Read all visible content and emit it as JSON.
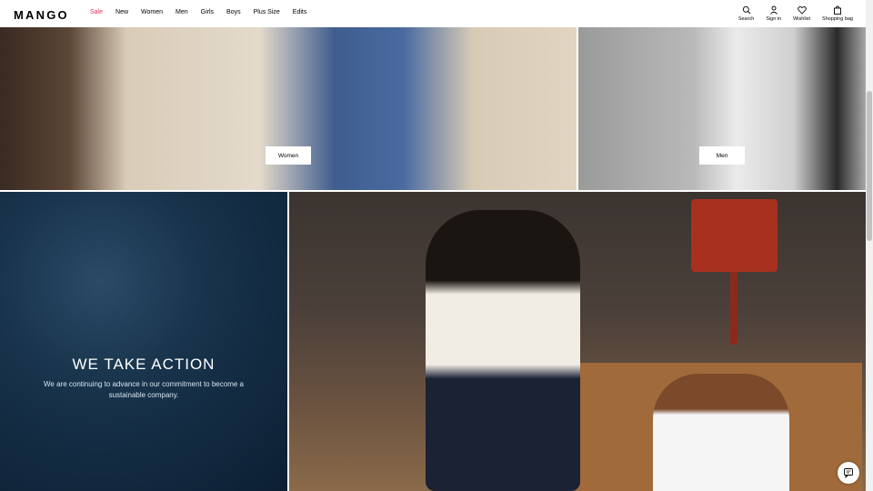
{
  "header": {
    "logo": "MANGO",
    "nav": [
      "Sale",
      "New",
      "Women",
      "Men",
      "Girls",
      "Boys",
      "Plus Size",
      "Edits"
    ],
    "icons": [
      {
        "icon": "search-icon",
        "label": "Search"
      },
      {
        "icon": "user-icon",
        "label": "Sign in"
      },
      {
        "icon": "heart-icon",
        "label": "Wishlist"
      },
      {
        "icon": "bag-icon",
        "label": "Shopping bag"
      }
    ]
  },
  "tiles": {
    "women_label": "Women",
    "men_label": "Men"
  },
  "action": {
    "title": "WE TAKE ACTION",
    "text": "We are continuing to advance in our commitment to become a sustainable company."
  },
  "colors": {
    "sale": "#e2335a"
  }
}
